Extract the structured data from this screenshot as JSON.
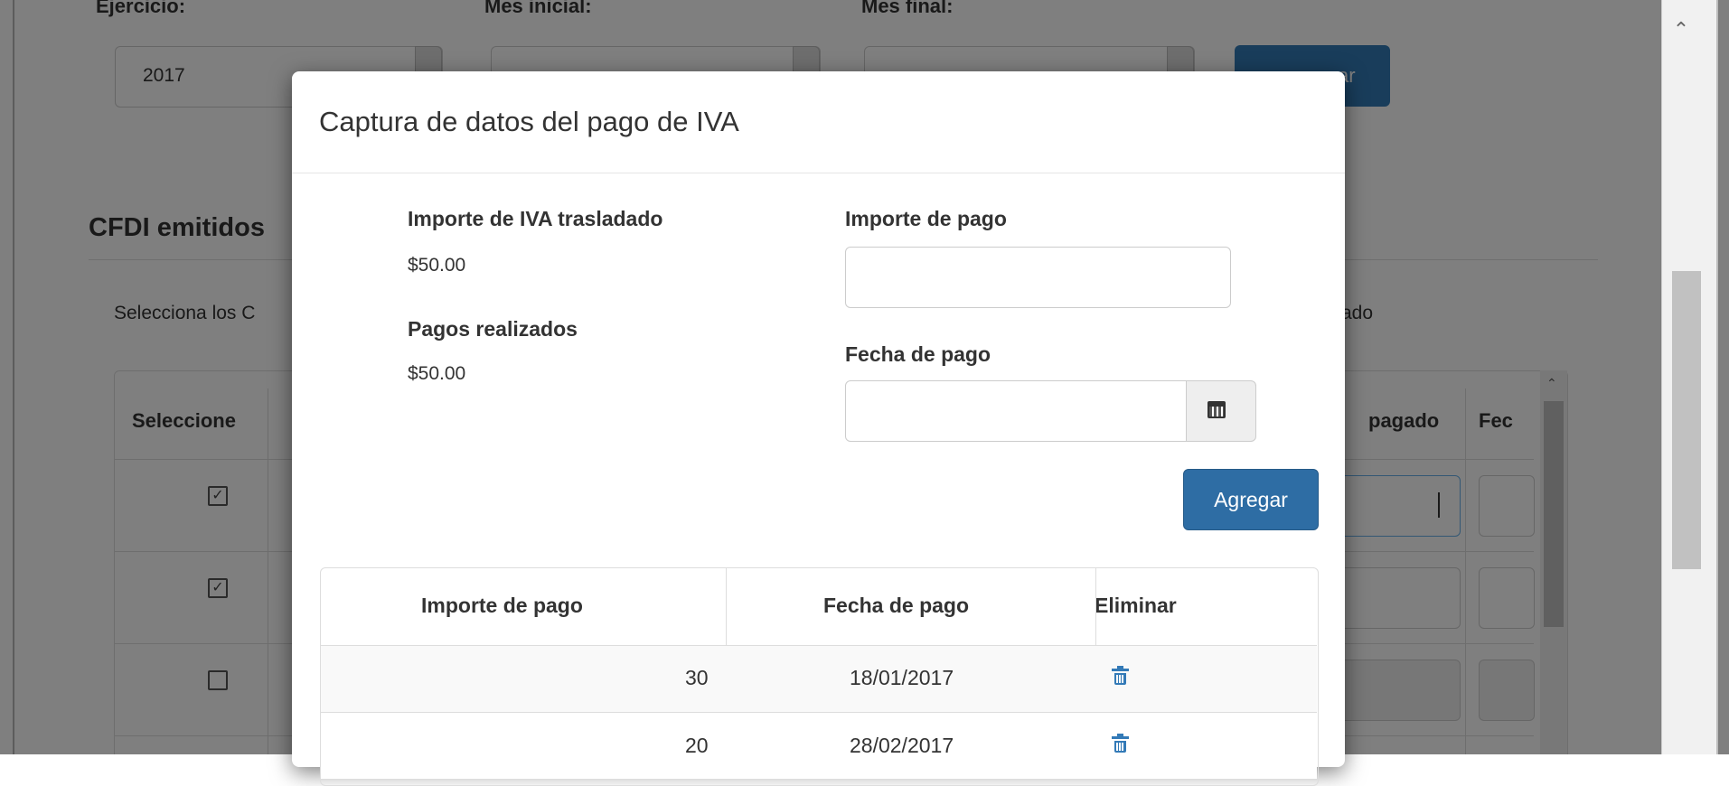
{
  "background": {
    "filters": {
      "ejercicio_label": "Ejercicio:",
      "ejercicio_value": "2017",
      "mes_inicial_label": "Mes inicial:",
      "mes_final_label": "Mes final:",
      "filter_button_fragment": "ar"
    },
    "section_title": "CFDI emitidos",
    "instructions_start": "Selecciona los C",
    "instructions_end": "ado",
    "table": {
      "columns": [
        "Seleccione",
        "pagado",
        "Fec"
      ],
      "rows": [
        {
          "checked": true
        },
        {
          "checked": true
        },
        {
          "checked": false
        }
      ]
    }
  },
  "modal": {
    "title": "Captura de datos del pago de IVA",
    "importe_iva_label": "Importe de IVA trasladado",
    "importe_iva_value": "$50.00",
    "pagos_label": "Pagos realizados",
    "pagos_value": "$50.00",
    "importe_pago_label": "Importe de pago",
    "importe_pago_value": "",
    "fecha_pago_label": "Fecha de pago",
    "fecha_pago_value": "",
    "add_button": "Agregar",
    "payments_table": {
      "headers": [
        "Importe de pago",
        "Fecha de pago",
        "Eliminar"
      ],
      "rows": [
        {
          "importe": "30",
          "fecha": "18/01/2017",
          "icon": "trash-icon"
        },
        {
          "importe": "20",
          "fecha": "28/02/2017",
          "icon": "trash-icon"
        }
      ]
    }
  }
}
